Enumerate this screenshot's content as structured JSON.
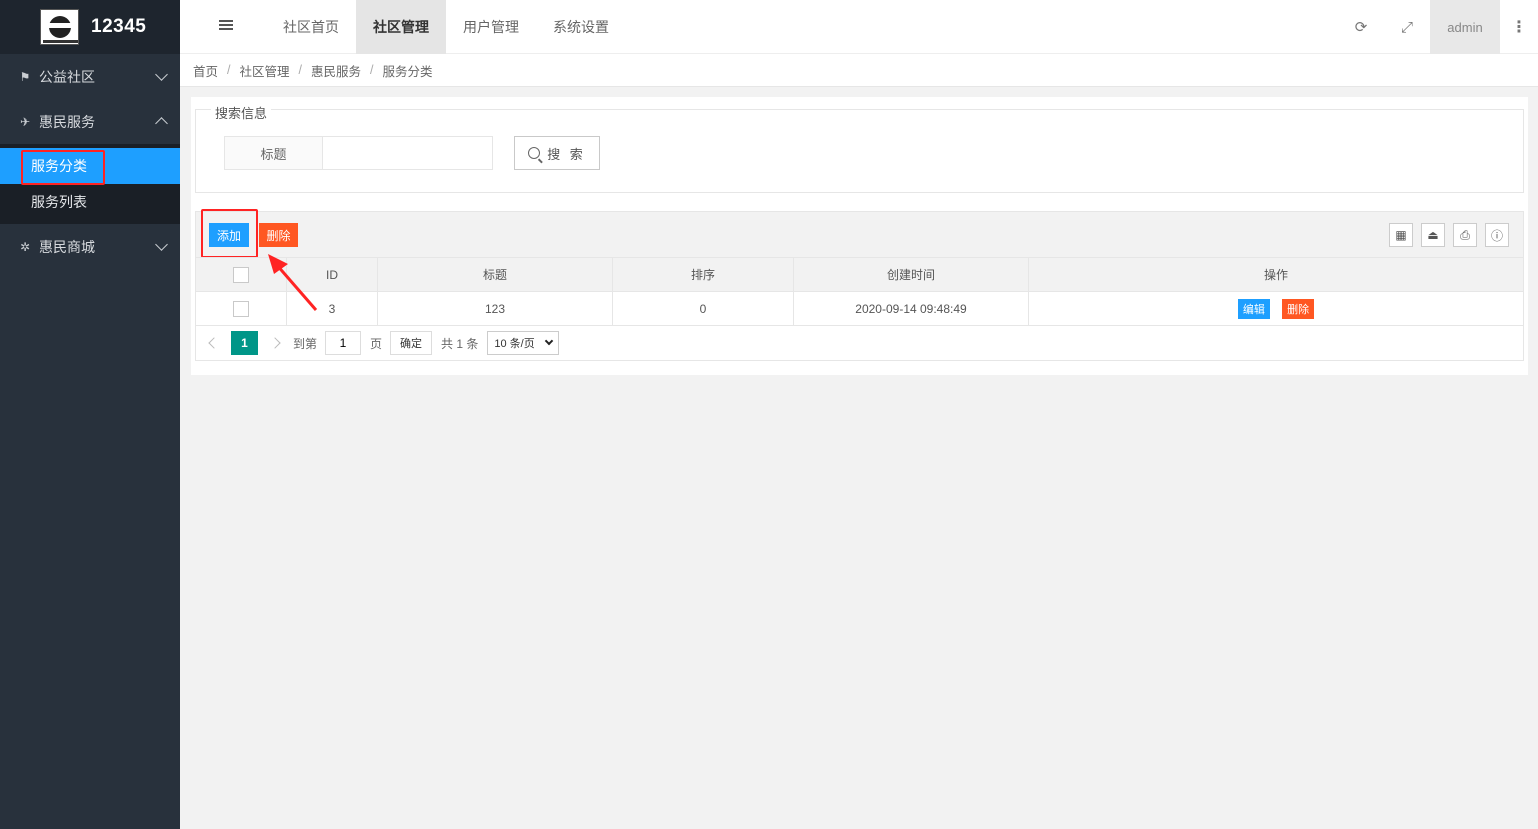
{
  "app": {
    "title": "12345"
  },
  "sidebar": {
    "items": [
      {
        "label": "公益社区",
        "icon": "flag-icon"
      },
      {
        "label": "惠民服务",
        "icon": "plane-icon",
        "children": [
          {
            "label": "服务分类",
            "active": true
          },
          {
            "label": "服务列表"
          }
        ]
      },
      {
        "label": "惠民商城",
        "icon": "sparkle-icon"
      }
    ]
  },
  "header": {
    "tabs": [
      {
        "label": "社区首页"
      },
      {
        "label": "社区管理",
        "active": true
      },
      {
        "label": "用户管理"
      },
      {
        "label": "系统设置"
      }
    ],
    "user": "admin"
  },
  "breadcrumb": [
    "首页",
    "社区管理",
    "惠民服务",
    "服务分类"
  ],
  "search": {
    "legend": "搜索信息",
    "field_label": "标题",
    "value": "",
    "button": "搜 索"
  },
  "toolbar": {
    "add": "添加",
    "delete": "删除"
  },
  "table": {
    "columns": [
      "ID",
      "标题",
      "排序",
      "创建时间",
      "操作"
    ],
    "rows": [
      {
        "id": "3",
        "title": "123",
        "sort": "0",
        "created": "2020-09-14 09:48:49",
        "edit": "编辑",
        "delete": "删除"
      }
    ]
  },
  "pager": {
    "current": "1",
    "goto_label": "到第",
    "goto_value": "1",
    "page_label": "页",
    "confirm": "确定",
    "total": "共 1 条",
    "page_size": "10 条/页"
  },
  "colors": {
    "primary": "#1e9fff",
    "danger": "#ff5722",
    "pager_active": "#009688",
    "sidebar": "#28313c",
    "highlight": "#ff2323"
  }
}
